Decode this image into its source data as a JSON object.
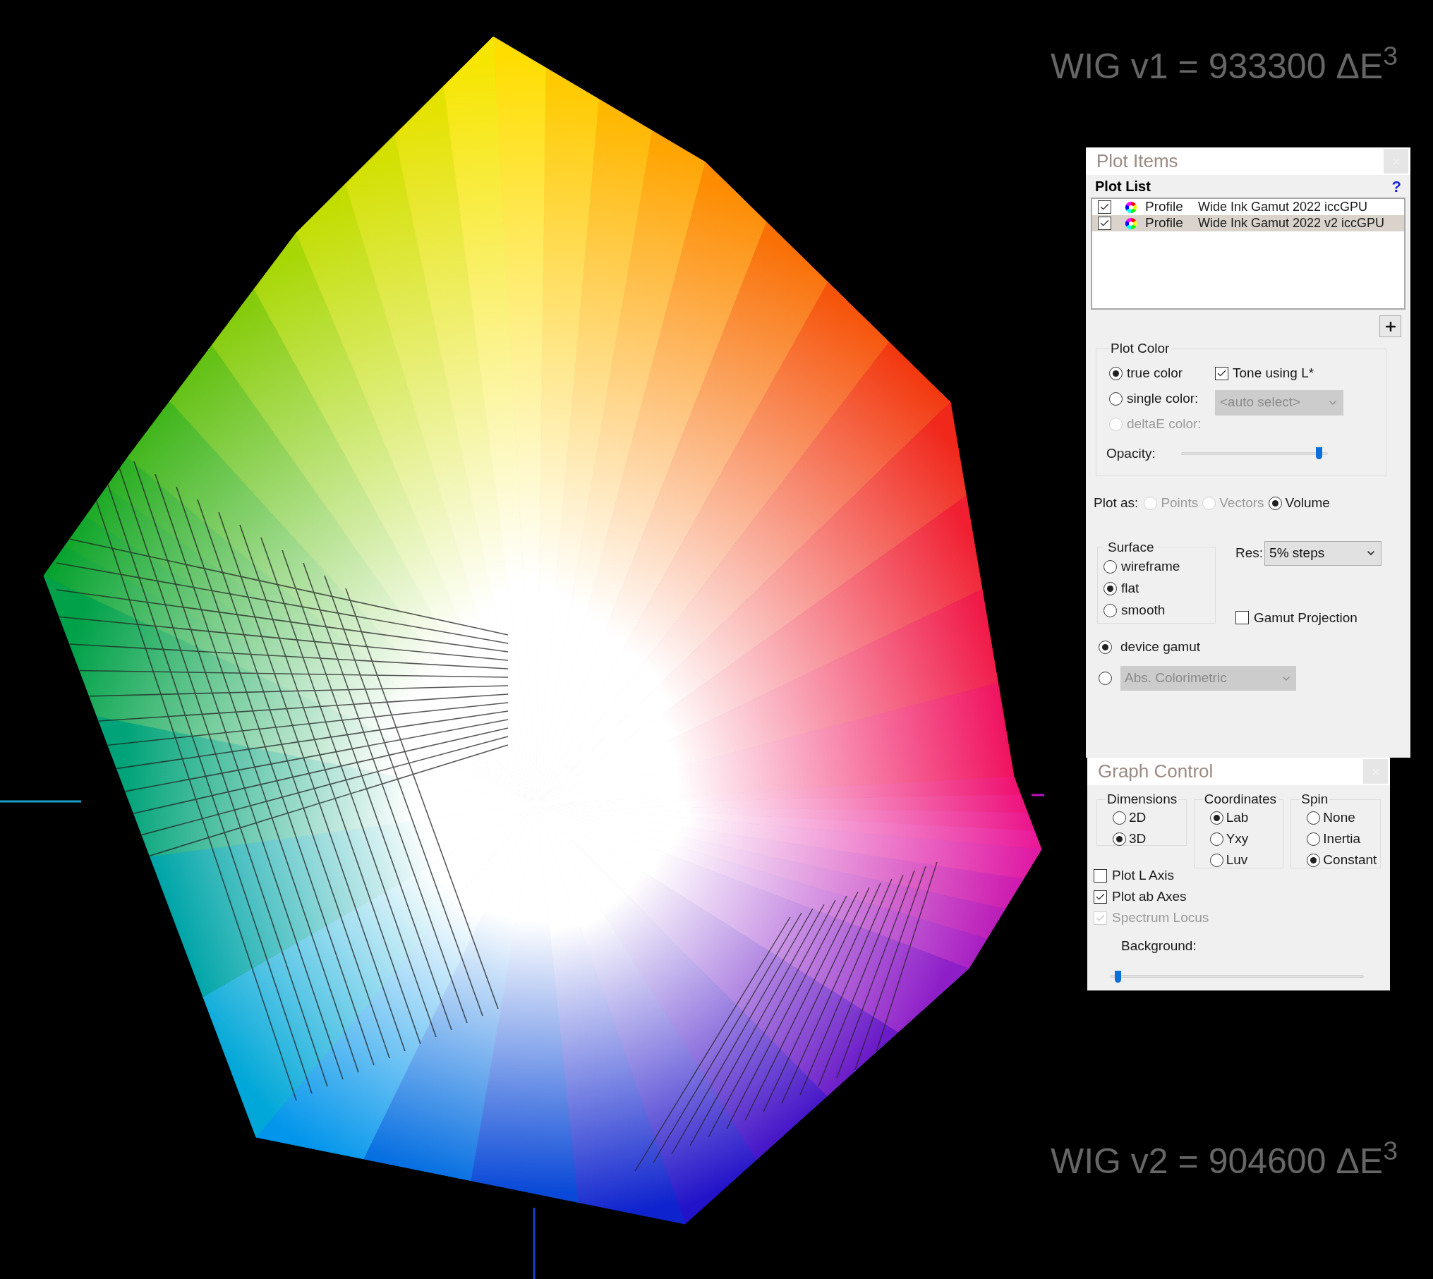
{
  "annotations": [
    {
      "text": "WIG v1 = 933300 ΔE$^{3}$"
    },
    {
      "text": "WIG v2 = 904600 ΔE$^{3}$"
    }
  ],
  "plot_items": {
    "title": "Plot Items",
    "plot_list": {
      "heading": "Plot List",
      "help": "?",
      "items": [
        {
          "checked": true,
          "selected": false,
          "type": "Profile",
          "name": "Wide Ink Gamut 2022 iccGPU"
        },
        {
          "checked": true,
          "selected": true,
          "type": "Profile",
          "name": "Wide Ink Gamut 2022 v2 iccGPU"
        }
      ]
    },
    "plot_color": {
      "legend": "Plot Color",
      "options": [
        {
          "label": "true color",
          "selected": true,
          "disabled": false
        },
        {
          "label": "single color:",
          "selected": false,
          "disabled": false
        },
        {
          "label": "deltaE color:",
          "selected": false,
          "disabled": true
        }
      ],
      "tone": {
        "label": "Tone using L*",
        "checked": true
      },
      "color_select": {
        "value": "<auto select>",
        "disabled": true
      },
      "opacity": {
        "label": "Opacity:",
        "level": 0.96
      }
    },
    "plot_as": {
      "label": "Plot as:",
      "options": [
        {
          "label": "Points",
          "selected": false,
          "disabled": true
        },
        {
          "label": "Vectors",
          "selected": false,
          "disabled": true
        },
        {
          "label": "Volume",
          "selected": true,
          "disabled": false
        }
      ]
    },
    "surface": {
      "legend": "Surface",
      "options": [
        {
          "label": "wireframe",
          "selected": false
        },
        {
          "label": "flat",
          "selected": true
        },
        {
          "label": "smooth",
          "selected": false
        }
      ]
    },
    "res": {
      "label": "Res:",
      "value": "5% steps"
    },
    "gamut_projection": {
      "label": "Gamut Projection",
      "checked": false
    },
    "gamut_mode": [
      {
        "kind": "label",
        "label": "device gamut",
        "selected": true
      },
      {
        "kind": "select",
        "value": "Abs. Colorimetric",
        "selected": false,
        "disabled": true
      }
    ]
  },
  "graph_control": {
    "title": "Graph Control",
    "groups": [
      {
        "legend": "Dimensions",
        "options": [
          {
            "label": "2D",
            "selected": false
          },
          {
            "label": "3D",
            "selected": true
          }
        ]
      },
      {
        "legend": "Coordinates",
        "options": [
          {
            "label": "Lab",
            "selected": true
          },
          {
            "label": "Yxy",
            "selected": false
          },
          {
            "label": "Luv",
            "selected": false
          }
        ]
      },
      {
        "legend": "Spin",
        "options": [
          {
            "label": "None",
            "selected": false
          },
          {
            "label": "Inertia",
            "selected": false
          },
          {
            "label": "Constant",
            "selected": true
          }
        ]
      }
    ],
    "checks": [
      {
        "label": "Plot L Axis",
        "checked": false,
        "disabled": false
      },
      {
        "label": "Plot ab Axes",
        "checked": true,
        "disabled": false
      },
      {
        "label": "Spectrum Locus",
        "checked": true,
        "disabled": true
      }
    ],
    "background": {
      "label": "Background:",
      "level": 0.02
    }
  }
}
